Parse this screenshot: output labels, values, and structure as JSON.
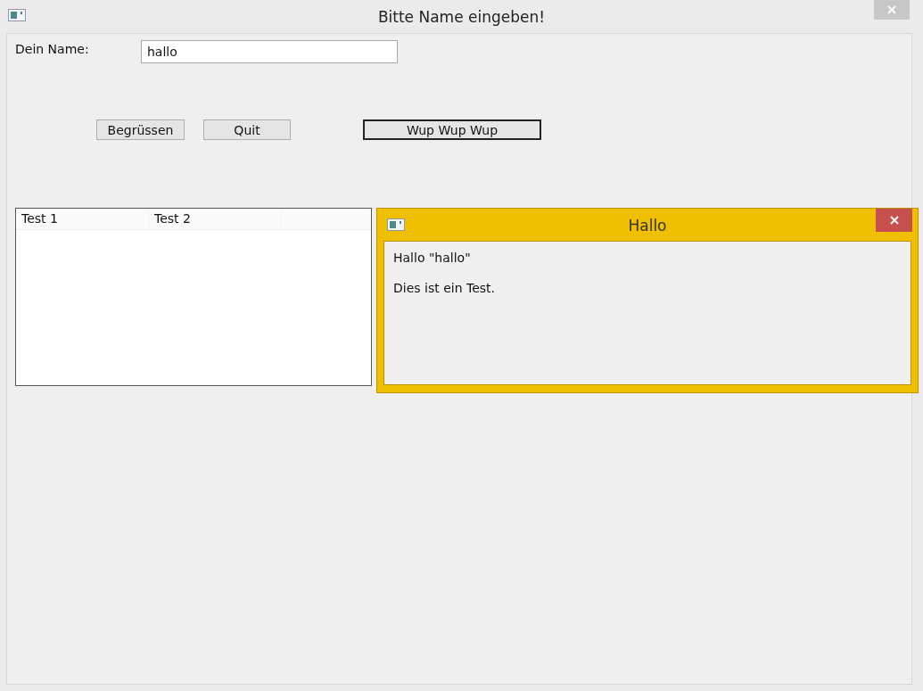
{
  "window": {
    "title": "Bitte Name eingeben!"
  },
  "name_field": {
    "label": "Dein Name:",
    "value": "hallo"
  },
  "buttons": [
    {
      "label": "Begrüssen",
      "focused": false
    },
    {
      "label": "Quit",
      "focused": false
    },
    {
      "label": "Wup Wup Wup",
      "focused": true
    }
  ],
  "table": {
    "columns": [
      "Test 1",
      "Test 2"
    ]
  },
  "dialog": {
    "title": "Hallo",
    "lines": [
      "Hallo \"hallo\"",
      "Dies ist ein Test."
    ]
  }
}
